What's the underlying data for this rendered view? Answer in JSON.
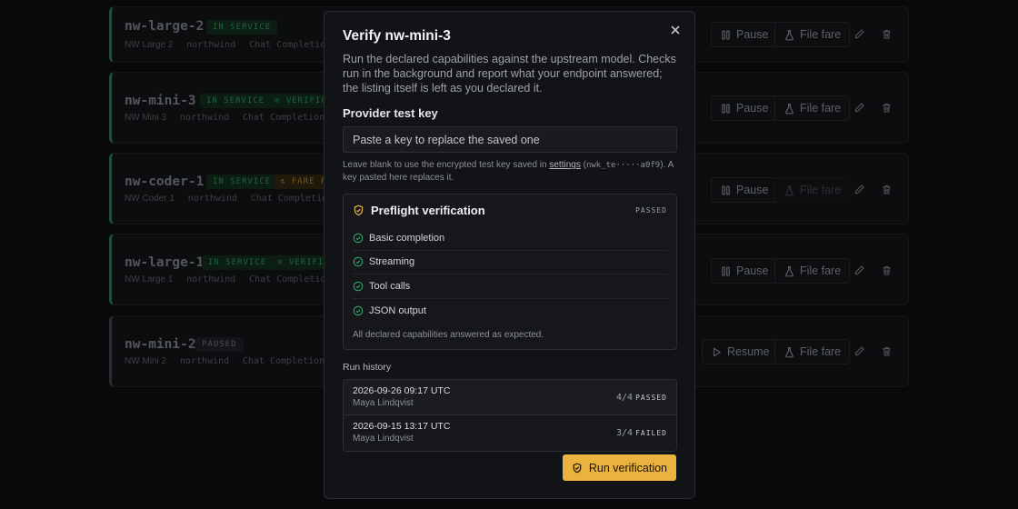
{
  "listing": [
    {
      "name": "nw-large-2",
      "subtitle": [
        "NW Large 2",
        "northwind",
        "Chat Completions"
      ],
      "badges": [
        {
          "text": "IN SERVICE",
          "kind": "service"
        }
      ],
      "primary_action": "Pause",
      "fare_action": "File fare",
      "fare_disabled": false,
      "paused": false
    },
    {
      "name": "nw-mini-3",
      "subtitle": [
        "NW Mini 3",
        "northwind",
        "Chat Completions"
      ],
      "badges": [
        {
          "text": "IN SERVICE",
          "kind": "service"
        },
        {
          "text": "VERIFICA",
          "kind": "verif"
        }
      ],
      "primary_action": "Pause",
      "fare_action": "File fare",
      "fare_disabled": false,
      "paused": false
    },
    {
      "name": "nw-coder-1",
      "subtitle": [
        "NW Coder 1",
        "northwind",
        "Chat Completions"
      ],
      "badges": [
        {
          "text": "IN SERVICE",
          "kind": "service"
        },
        {
          "text": "FARE FI",
          "kind": "fare"
        }
      ],
      "primary_action": "Pause",
      "fare_action": "File fare",
      "fare_disabled": true,
      "paused": false
    },
    {
      "name": "nw-large-1",
      "subtitle": [
        "NW Large 1",
        "northwind",
        "Chat Completions"
      ],
      "badges": [
        {
          "text": "IN SERVICE",
          "kind": "service"
        },
        {
          "text": "VERIFI",
          "kind": "verif"
        }
      ],
      "primary_action": "Pause",
      "fare_action": "File fare",
      "fare_disabled": false,
      "paused": false
    },
    {
      "name": "nw-mini-2",
      "subtitle": [
        "NW Mini 2",
        "northwind",
        "Chat Completions"
      ],
      "badges": [
        {
          "text": "PAUSED",
          "kind": "paused"
        }
      ],
      "primary_action": "Resume",
      "fare_action": "File fare",
      "fare_disabled": false,
      "paused": true
    }
  ],
  "modal": {
    "title": "Verify nw-mini-3",
    "description": "Run the declared capabilities against the upstream model. Checks run in the background and report what your endpoint answered; the listing itself is left as you declared it.",
    "key_label": "Provider test key",
    "key_placeholder": "Paste a key to replace the saved one",
    "help_before": "Leave blank to use the encrypted test key saved in ",
    "help_link": "settings",
    "help_mid": " (",
    "help_key": "nwk_te·····a0f9",
    "help_after": "). A key pasted here replaces it.",
    "preflight": {
      "title": "Preflight verification",
      "status": "PASSED",
      "checks": [
        "Basic completion",
        "Streaming",
        "Tool calls",
        "JSON output"
      ],
      "note": "All declared capabilities answered as expected."
    },
    "history_label": "Run history",
    "history": [
      {
        "time": "2026-09-26 09:17 UTC",
        "user": "Maya Lindqvist",
        "score": "4/4",
        "status": "PASSED"
      },
      {
        "time": "2026-09-15 13:17 UTC",
        "user": "Maya Lindqvist",
        "score": "3/4",
        "status": "FAILED"
      }
    ],
    "run_button": "Run verification"
  },
  "icons": {
    "close": "close-icon",
    "shield": "shield-icon",
    "check": "check-circle-icon",
    "pause": "pause-icon",
    "play": "play-icon",
    "fare": "flask-icon",
    "edit": "pencil-icon",
    "delete": "trash-icon"
  }
}
